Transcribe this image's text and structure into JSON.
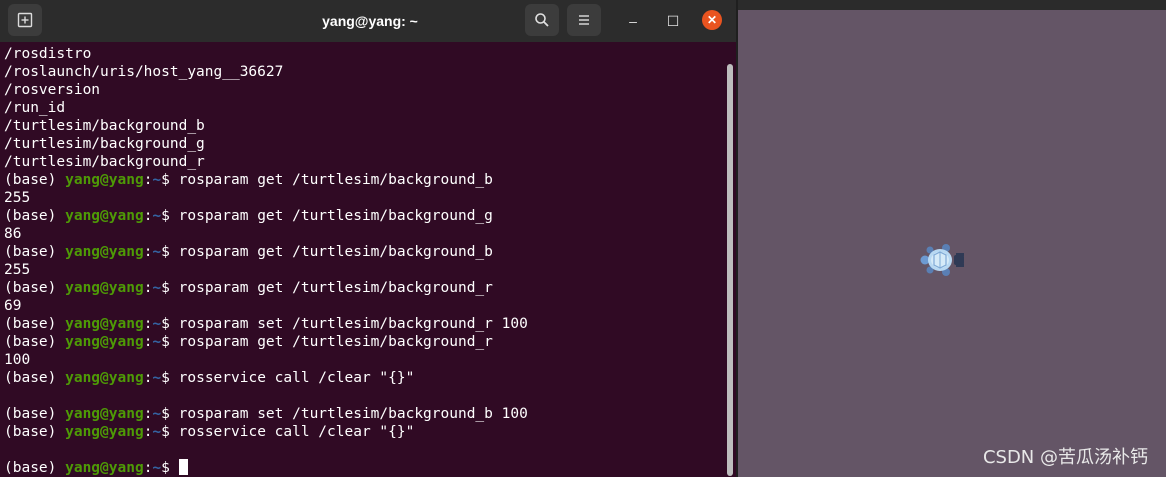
{
  "window": {
    "title": "yang@yang: ~",
    "new_tab_icon": "new-tab-icon",
    "search_icon": "search-icon",
    "menu_icon": "hamburger-menu-icon",
    "minimize_label": "–",
    "maximize_label": "☐",
    "close_label": "✕",
    "accent_color": "#e95420"
  },
  "terminal": {
    "background_color": "#300a24",
    "user_color": "#4e9a06",
    "path_color": "#3465a4",
    "prompt": {
      "env": "(base) ",
      "user": "yang@yang",
      "sep": ":",
      "dir": "~",
      "symbol": "$ "
    },
    "lines": [
      {
        "type": "out",
        "text": "/rosdistro"
      },
      {
        "type": "out",
        "text": "/roslaunch/uris/host_yang__36627"
      },
      {
        "type": "out",
        "text": "/rosversion"
      },
      {
        "type": "out",
        "text": "/run_id"
      },
      {
        "type": "out",
        "text": "/turtlesim/background_b"
      },
      {
        "type": "out",
        "text": "/turtlesim/background_g"
      },
      {
        "type": "out",
        "text": "/turtlesim/background_r"
      },
      {
        "type": "cmd",
        "text": "rosparam get /turtlesim/background_b"
      },
      {
        "type": "out",
        "text": "255"
      },
      {
        "type": "cmd",
        "text": "rosparam get /turtlesim/background_g"
      },
      {
        "type": "out",
        "text": "86"
      },
      {
        "type": "cmd",
        "text": "rosparam get /turtlesim/background_b"
      },
      {
        "type": "out",
        "text": "255"
      },
      {
        "type": "cmd",
        "text": "rosparam get /turtlesim/background_r"
      },
      {
        "type": "out",
        "text": "69"
      },
      {
        "type": "cmd",
        "text": "rosparam set /turtlesim/background_r 100"
      },
      {
        "type": "cmd",
        "text": "rosparam get /turtlesim/background_r"
      },
      {
        "type": "out",
        "text": "100"
      },
      {
        "type": "cmd",
        "text": "rosservice call /clear \"{}\""
      },
      {
        "type": "out",
        "text": ""
      },
      {
        "type": "cmd",
        "text": "rosparam set /turtlesim/background_b 100"
      },
      {
        "type": "cmd",
        "text": "rosservice call /clear \"{}\""
      },
      {
        "type": "out",
        "text": ""
      },
      {
        "type": "cmd",
        "text": "",
        "cursor": true
      }
    ]
  },
  "turtlesim": {
    "background_color": "#645566",
    "turtle_icon": "turtle-icon"
  },
  "watermark": "CSDN @苦瓜汤补钙"
}
